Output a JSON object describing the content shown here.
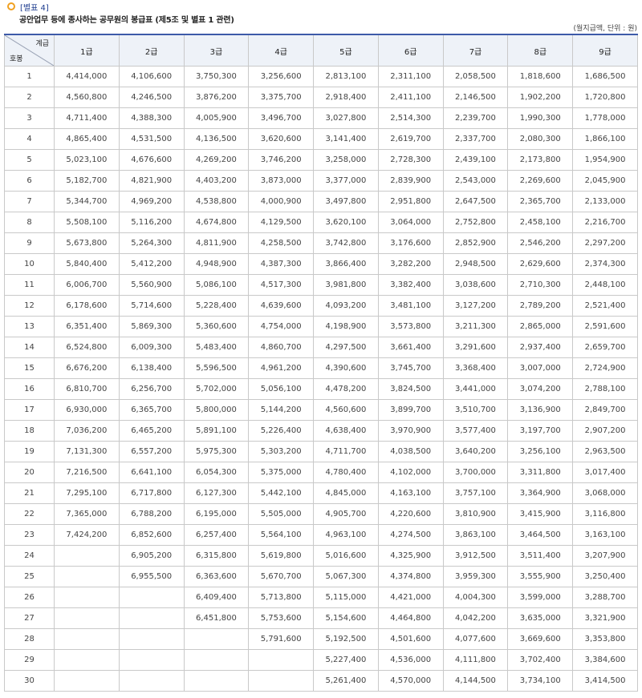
{
  "header": {
    "annex_label": "[별표 4]",
    "title": "공안업무 등에 종사하는 공무원의 봉급표 (제5조 및 별표 1 관련)",
    "unit_note": "(월지급액, 단위 : 원)"
  },
  "table": {
    "corner_grade": "계급",
    "corner_step": "호봉",
    "grades": [
      "1급",
      "2급",
      "3급",
      "4급",
      "5급",
      "6급",
      "7급",
      "8급",
      "9급"
    ],
    "rows": [
      [
        "1",
        "4,414,000",
        "4,106,600",
        "3,750,300",
        "3,256,600",
        "2,813,100",
        "2,311,100",
        "2,058,500",
        "1,818,600",
        "1,686,500"
      ],
      [
        "2",
        "4,560,800",
        "4,246,500",
        "3,876,200",
        "3,375,700",
        "2,918,400",
        "2,411,100",
        "2,146,500",
        "1,902,200",
        "1,720,800"
      ],
      [
        "3",
        "4,711,400",
        "4,388,300",
        "4,005,900",
        "3,496,700",
        "3,027,800",
        "2,514,300",
        "2,239,700",
        "1,990,300",
        "1,778,000"
      ],
      [
        "4",
        "4,865,400",
        "4,531,500",
        "4,136,500",
        "3,620,600",
        "3,141,400",
        "2,619,700",
        "2,337,700",
        "2,080,300",
        "1,866,100"
      ],
      [
        "5",
        "5,023,100",
        "4,676,600",
        "4,269,200",
        "3,746,200",
        "3,258,000",
        "2,728,300",
        "2,439,100",
        "2,173,800",
        "1,954,900"
      ],
      [
        "6",
        "5,182,700",
        "4,821,900",
        "4,403,200",
        "3,873,000",
        "3,377,000",
        "2,839,900",
        "2,543,000",
        "2,269,600",
        "2,045,900"
      ],
      [
        "7",
        "5,344,700",
        "4,969,200",
        "4,538,800",
        "4,000,900",
        "3,497,800",
        "2,951,800",
        "2,647,500",
        "2,365,700",
        "2,133,000"
      ],
      [
        "8",
        "5,508,100",
        "5,116,200",
        "4,674,800",
        "4,129,500",
        "3,620,100",
        "3,064,000",
        "2,752,800",
        "2,458,100",
        "2,216,700"
      ],
      [
        "9",
        "5,673,800",
        "5,264,300",
        "4,811,900",
        "4,258,500",
        "3,742,800",
        "3,176,600",
        "2,852,900",
        "2,546,200",
        "2,297,200"
      ],
      [
        "10",
        "5,840,400",
        "5,412,200",
        "4,948,900",
        "4,387,300",
        "3,866,400",
        "3,282,200",
        "2,948,500",
        "2,629,600",
        "2,374,300"
      ],
      [
        "11",
        "6,006,700",
        "5,560,900",
        "5,086,100",
        "4,517,300",
        "3,981,800",
        "3,382,400",
        "3,038,600",
        "2,710,300",
        "2,448,100"
      ],
      [
        "12",
        "6,178,600",
        "5,714,600",
        "5,228,400",
        "4,639,600",
        "4,093,200",
        "3,481,100",
        "3,127,200",
        "2,789,200",
        "2,521,400"
      ],
      [
        "13",
        "6,351,400",
        "5,869,300",
        "5,360,600",
        "4,754,000",
        "4,198,900",
        "3,573,800",
        "3,211,300",
        "2,865,000",
        "2,591,600"
      ],
      [
        "14",
        "6,524,800",
        "6,009,300",
        "5,483,400",
        "4,860,700",
        "4,297,500",
        "3,661,400",
        "3,291,600",
        "2,937,400",
        "2,659,700"
      ],
      [
        "15",
        "6,676,200",
        "6,138,400",
        "5,596,500",
        "4,961,200",
        "4,390,600",
        "3,745,700",
        "3,368,400",
        "3,007,000",
        "2,724,900"
      ],
      [
        "16",
        "6,810,700",
        "6,256,700",
        "5,702,000",
        "5,056,100",
        "4,478,200",
        "3,824,500",
        "3,441,000",
        "3,074,200",
        "2,788,100"
      ],
      [
        "17",
        "6,930,000",
        "6,365,700",
        "5,800,000",
        "5,144,200",
        "4,560,600",
        "3,899,700",
        "3,510,700",
        "3,136,900",
        "2,849,700"
      ],
      [
        "18",
        "7,036,200",
        "6,465,200",
        "5,891,100",
        "5,226,400",
        "4,638,400",
        "3,970,900",
        "3,577,400",
        "3,197,700",
        "2,907,200"
      ],
      [
        "19",
        "7,131,300",
        "6,557,200",
        "5,975,300",
        "5,303,200",
        "4,711,700",
        "4,038,500",
        "3,640,200",
        "3,256,100",
        "2,963,500"
      ],
      [
        "20",
        "7,216,500",
        "6,641,100",
        "6,054,300",
        "5,375,000",
        "4,780,400",
        "4,102,000",
        "3,700,000",
        "3,311,800",
        "3,017,400"
      ],
      [
        "21",
        "7,295,100",
        "6,717,800",
        "6,127,300",
        "5,442,100",
        "4,845,000",
        "4,163,100",
        "3,757,100",
        "3,364,900",
        "3,068,000"
      ],
      [
        "22",
        "7,365,000",
        "6,788,200",
        "6,195,000",
        "5,505,000",
        "4,905,700",
        "4,220,600",
        "3,810,900",
        "3,415,900",
        "3,116,800"
      ],
      [
        "23",
        "7,424,200",
        "6,852,600",
        "6,257,400",
        "5,564,100",
        "4,963,100",
        "4,274,500",
        "3,863,100",
        "3,464,500",
        "3,163,100"
      ],
      [
        "24",
        "",
        "6,905,200",
        "6,315,800",
        "5,619,800",
        "5,016,600",
        "4,325,900",
        "3,912,500",
        "3,511,400",
        "3,207,900"
      ],
      [
        "25",
        "",
        "6,955,500",
        "6,363,600",
        "5,670,700",
        "5,067,300",
        "4,374,800",
        "3,959,300",
        "3,555,900",
        "3,250,400"
      ],
      [
        "26",
        "",
        "",
        "6,409,400",
        "5,713,800",
        "5,115,000",
        "4,421,000",
        "4,004,300",
        "3,599,000",
        "3,288,700"
      ],
      [
        "27",
        "",
        "",
        "6,451,800",
        "5,753,600",
        "5,154,600",
        "4,464,800",
        "4,042,200",
        "3,635,000",
        "3,321,900"
      ],
      [
        "28",
        "",
        "",
        "",
        "5,791,600",
        "5,192,500",
        "4,501,600",
        "4,077,600",
        "3,669,600",
        "3,353,800"
      ],
      [
        "29",
        "",
        "",
        "",
        "",
        "5,227,400",
        "4,536,000",
        "4,111,800",
        "3,702,400",
        "3,384,600"
      ],
      [
        "30",
        "",
        "",
        "",
        "",
        "5,261,400",
        "4,570,000",
        "4,144,500",
        "3,734,100",
        "3,414,500"
      ]
    ]
  }
}
